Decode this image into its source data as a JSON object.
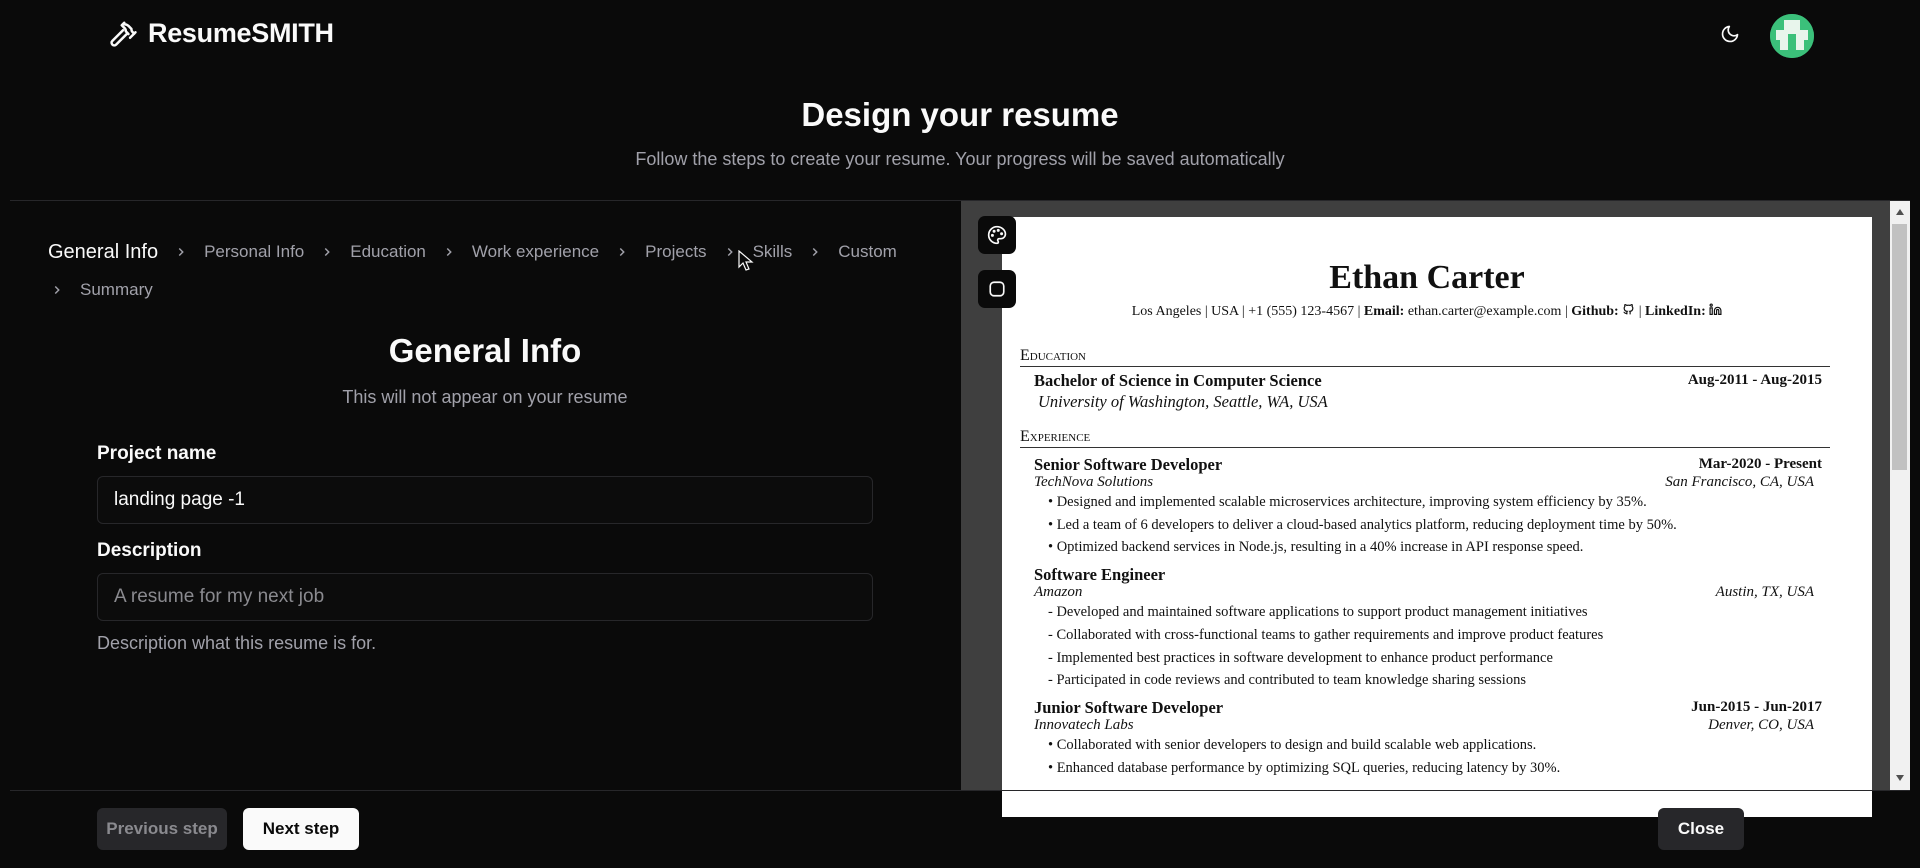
{
  "header": {
    "brand": "ResumeSMITH",
    "brand_icon": "hammer-icon",
    "theme_icon": "moon-icon"
  },
  "hero": {
    "title": "Design your resume",
    "subtitle": "Follow the steps to create your resume. Your progress will be saved automatically"
  },
  "stepper": {
    "steps": [
      "General Info",
      "Personal Info",
      "Education",
      "Work experience",
      "Projects",
      "Skills",
      "Custom",
      "Summary"
    ],
    "active": "General Info"
  },
  "form": {
    "title": "General Info",
    "subtitle": "This will not appear on your resume",
    "project_name_label": "Project name",
    "project_name_value": "landing page -1",
    "description_label": "Description",
    "description_placeholder": "A resume for my next job",
    "description_helper": "Description what this resume is for."
  },
  "preview": {
    "tools": [
      "palette-icon",
      "square-icon"
    ],
    "resume": {
      "name": "Ethan Carter",
      "contact": {
        "location": "Los Angeles | USA | +1 (555) 123-4567 | ",
        "email_label": "Email:",
        "email": " ethan.carter@example.com",
        "sep": " | ",
        "github_label": "Github:",
        "linkedin_label": "LinkedIn:"
      },
      "education_heading": "Education",
      "education": [
        {
          "degree": "Bachelor of Science in Computer Science",
          "dates": "Aug-2011 - Aug-2015",
          "school": "University of Washington, Seattle, WA, USA"
        }
      ],
      "experience_heading": "Experience",
      "experience": [
        {
          "title": "Senior Software Developer",
          "dates": "Mar-2020 - Present",
          "company": "TechNova Solutions",
          "location": "San Francisco, CA, USA",
          "bullets": [
            "• Designed and implemented scalable microservices architecture, improving system efficiency by 35%.",
            "• Led a team of 6 developers to deliver a cloud-based analytics platform, reducing deployment time by 50%.",
            "• Optimized backend services in Node.js, resulting in a 40% increase in API response speed."
          ]
        },
        {
          "title": "Software Engineer",
          "dates": "",
          "company": "Amazon",
          "location": "Austin, TX, USA",
          "bullets": [
            "- Developed and maintained software applications to support product management initiatives",
            "- Collaborated with cross-functional teams to gather requirements and improve product features",
            "- Implemented best practices in software development to enhance product performance",
            "- Participated in code reviews and contributed to team knowledge sharing sessions"
          ]
        },
        {
          "title": "Junior Software Developer",
          "dates": "Jun-2015 - Jun-2017",
          "company": "Innovatech Labs",
          "location": "Denver, CO, USA",
          "bullets": [
            "• Collaborated with senior developers to design and build scalable web applications.",
            "• Enhanced database performance by optimizing SQL queries, reducing latency by 30%."
          ]
        }
      ]
    }
  },
  "footer": {
    "previous": "Previous step",
    "next": "Next step",
    "close": "Close"
  },
  "colors": {
    "background": "#0a0a0a",
    "muted_text": "#a1a1aa",
    "border": "#27272a",
    "avatar": "#3bc07a"
  }
}
